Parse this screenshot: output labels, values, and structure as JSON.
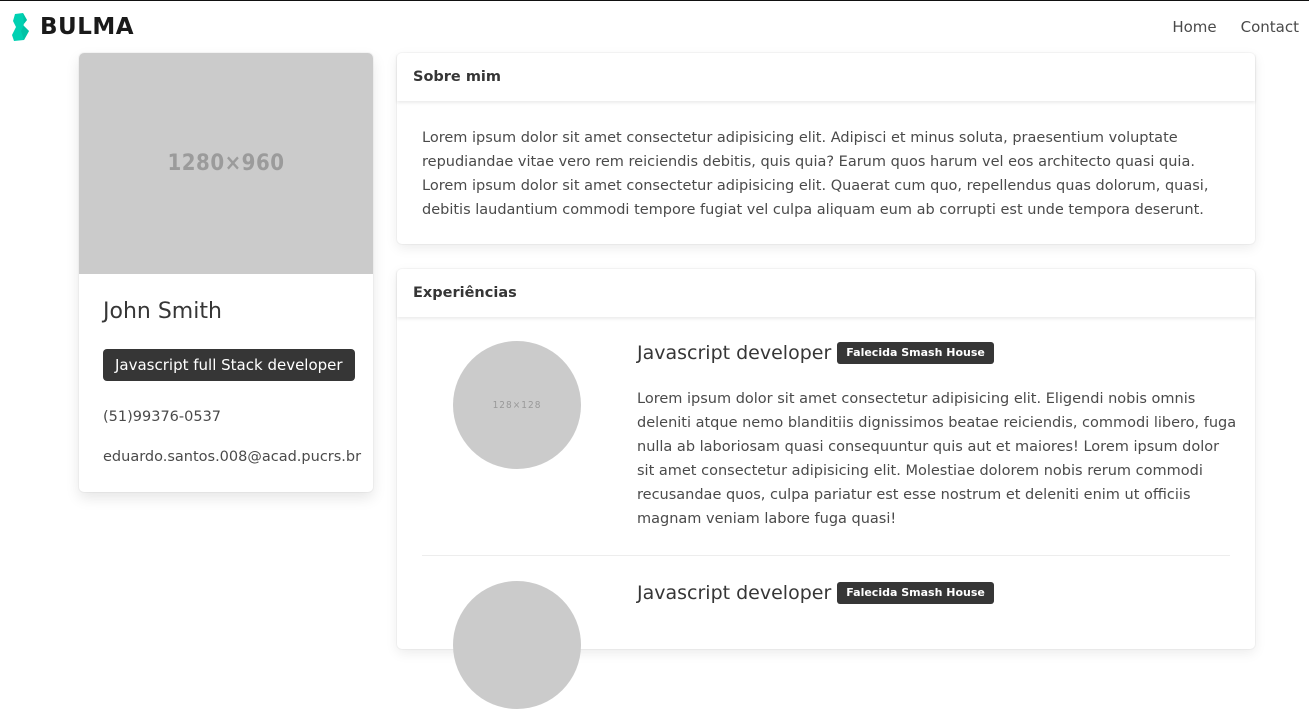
{
  "navbar": {
    "brand": "BULMA",
    "items": [
      {
        "label": "Home"
      },
      {
        "label": "Contact"
      }
    ]
  },
  "profile": {
    "image_placeholder": "1280×960",
    "name": "John Smith",
    "role_tag": "Javascript full Stack developer",
    "phone": "(51)99376-0537",
    "email": "eduardo.santos.008@acad.pucrs.br"
  },
  "about": {
    "title": "Sobre mim",
    "text": "Lorem ipsum dolor sit amet consectetur adipisicing elit. Adipisci et minus soluta, praesentium voluptate repudiandae vitae vero rem reiciendis debitis, quis quia? Earum quos harum vel eos architecto quasi quia. Lorem ipsum dolor sit amet consectetur adipisicing elit. Quaerat cum quo, repellendus quas dolorum, quasi, debitis laudantium commodi tempore fugiat vel culpa aliquam eum ab corrupti est unde tempora deserunt."
  },
  "experiences": {
    "title": "Experiências",
    "items": [
      {
        "avatar_placeholder": "128×128",
        "title": "Javascript developer",
        "company": "Falecida Smash House",
        "description": "Lorem ipsum dolor sit amet consectetur adipisicing elit. Eligendi nobis omnis deleniti atque nemo blanditiis dignissimos beatae reiciendis, commodi libero, fuga nulla ab laboriosam quasi consequuntur quis aut et maiores! Lorem ipsum dolor sit amet consectetur adipisicing elit. Molestiae dolorem nobis rerum commodi recusandae quos, culpa pariatur est esse nostrum et deleniti enim ut officiis magnam veniam labore fuga quasi!"
      },
      {
        "title": "Javascript developer",
        "company": "Falecida Smash House"
      }
    ]
  },
  "colors": {
    "brand_accent": "#00d1b2",
    "dark_tag": "#363636",
    "placeholder_gray": "#cbcbcb"
  }
}
